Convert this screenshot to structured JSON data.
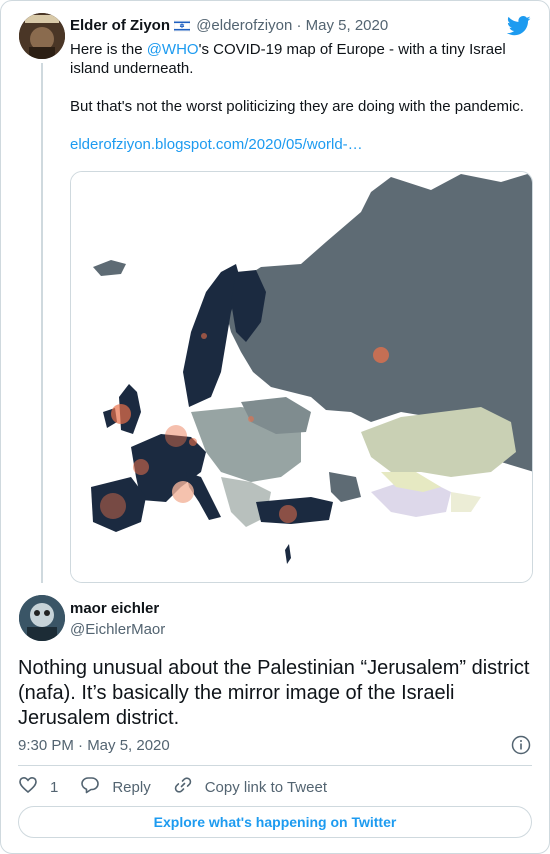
{
  "parent_tweet": {
    "author_name": "Elder of Ziyon",
    "author_flag": "israel-flag-icon",
    "handle": "@elderofziyon",
    "separator": "·",
    "date": "May 5, 2020",
    "text_before_mention": "Here is the ",
    "mention": "@WHO",
    "text_after_mention": "'s COVID-19 map of Europe - with a tiny Israel island underneath.",
    "paragraph_2": "But that's not the worst politicizing they are doing with the pandemic.",
    "link": "elderofziyon.blogspot.com/2020/05/world-…",
    "media": "covid-19-europe-map"
  },
  "reply_tweet": {
    "author_name": "maor eichler",
    "handle": "@EichlerMaor",
    "text": "Nothing unusual about the Palestinian “Jerusalem” district (nafa). It’s basically the mirror image of the Israeli Jerusalem district.",
    "timestamp": "9:30 PM · May 5, 2020"
  },
  "actions": {
    "like_count": "1",
    "reply_label": "Reply",
    "copy_link_label": "Copy link to Tweet"
  },
  "footer": {
    "explore_label": "Explore what's happening on Twitter"
  },
  "colors": {
    "link": "#1d9bf0",
    "muted_text": "#536471",
    "border": "#cfd9de",
    "map_land": "#5e6b74",
    "map_dark": "#1b2a40",
    "map_light": "#c9d0b4",
    "hotspot": "#e8704a"
  }
}
